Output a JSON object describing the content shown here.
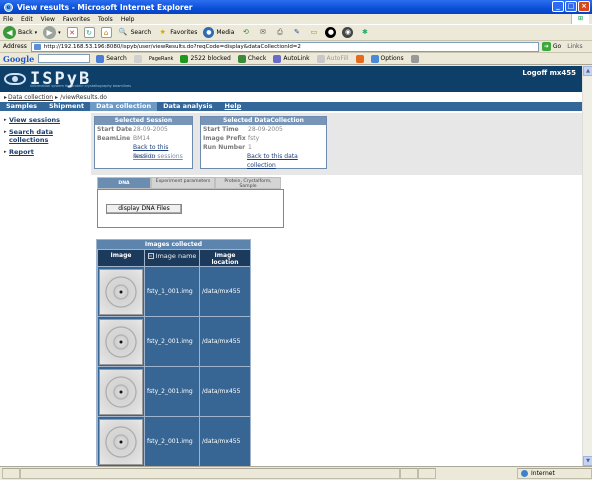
{
  "window": {
    "title": "View results - Microsoft Internet Explorer",
    "controls": [
      "_",
      "□",
      "×"
    ]
  },
  "menu": [
    "File",
    "Edit",
    "View",
    "Favorites",
    "Tools",
    "Help"
  ],
  "toolbar": {
    "back": "Back",
    "search": "Search",
    "favorites": "Favorites",
    "media": "Media"
  },
  "address": {
    "label": "Address",
    "url": "http://192.168.53.196:8080/ispyb/user/viewResults.do?reqCode=display&dataCollectionId=2",
    "go": "Go",
    "links": "Links"
  },
  "googlebar": {
    "logo": "Google",
    "search": "Search",
    "pagerank": "PageRank",
    "blocked": "2522 blocked",
    "check": "Check",
    "autolink": "AutoLink",
    "autofill": "AutoFill",
    "options": "Options"
  },
  "banner": {
    "logo": "ISPyB",
    "subtitle": "information system for protein crystallography beamlines",
    "logoff": "Logoff mx455"
  },
  "breadcrumb": {
    "item1": "Data collection",
    "sep": "/",
    "item2": "/viewResults.do"
  },
  "nav": [
    "Samples",
    "Shipment",
    "Data collection",
    "Data analysis",
    "Help"
  ],
  "sidebar": [
    "View sessions",
    "Search data collections",
    "Report"
  ],
  "session": {
    "title": "Selected Session",
    "start_label": "Start Date",
    "start_value": "28-09-2005",
    "beamline_label": "BeamLine",
    "beamline_value": "BM14",
    "link_back_session": "Back to this session",
    "link_back_sessions": "Back to sessions"
  },
  "datacollection": {
    "title": "Selected DataCollection",
    "start_label": "Start Time",
    "start_value": "28-09-2005",
    "prefix_label": "Image Prefix",
    "prefix_value": "fsty",
    "run_label": "Run Number",
    "run_value": "1",
    "link_back": "Back to this data collection"
  },
  "tabs": {
    "dna": "DNA",
    "experiment": "Experiment parameters",
    "protein": "Protein, Crystalform, Sample"
  },
  "dna_button": "display DNA Files",
  "images": {
    "caption": "Images collected",
    "col_image": "Image",
    "col_name": "Image name",
    "col_location": "Image location",
    "rows": [
      {
        "name": "fsty_1_001.img",
        "location": "/data/mx455"
      },
      {
        "name": "fsty_2_001.img",
        "location": "/data/mx455"
      },
      {
        "name": "fsty_2_001.img",
        "location": "/data/mx455"
      },
      {
        "name": "fsty_2_001.img",
        "location": "/data/mx455"
      }
    ]
  },
  "status": {
    "zone": "Internet"
  }
}
